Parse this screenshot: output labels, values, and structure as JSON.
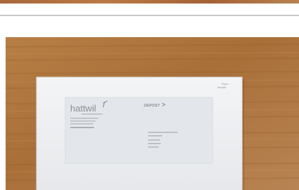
{
  "photo": {
    "subject": "envelope on wooden table",
    "colors": {
      "wood": "#b07a43",
      "wood_dark": "#8f5a2c",
      "envelope": "#eef0f2",
      "window": "#e3e6ea",
      "ink": "#8a8f96"
    },
    "envelope": {
      "stamp_line_1": "Porto",
      "stamp_line_2": "bezahlt",
      "sender_logo": "hattwil",
      "postal_logo": "DEPOST"
    }
  }
}
